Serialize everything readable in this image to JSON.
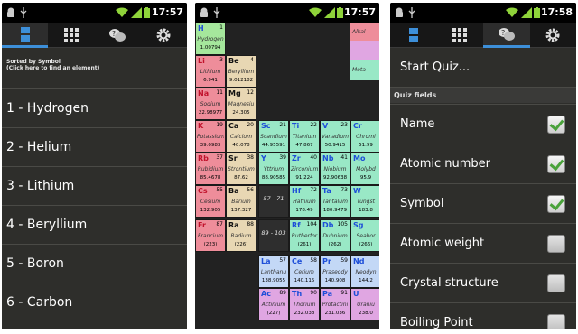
{
  "screens": [
    {
      "clock": "17:57",
      "tabs": [
        "elements-list",
        "periodic-table",
        "quiz",
        "settings"
      ],
      "sort_title": "Sorted by Symbol",
      "sort_hint": "(Click here to find an element)",
      "elements": [
        "1 - Hydrogen",
        "2 - Helium",
        "3 - Lithium",
        "4 - Beryllium",
        "5 - Boron",
        "6 - Carbon"
      ]
    },
    {
      "clock": "17:57",
      "legend": [
        "Alkal",
        "",
        "Meta"
      ],
      "cells": [
        {
          "sym": "H",
          "num": "1",
          "name": "Hydrogen",
          "weight": "1.00794"
        },
        {
          "sym": "Li",
          "num": "3",
          "name": "Lithium",
          "weight": "6.941"
        },
        {
          "sym": "Be",
          "num": "4",
          "name": "Beryllium",
          "weight": "9.012182"
        },
        {
          "sym": "Na",
          "num": "11",
          "name": "Sodium",
          "weight": "22.98977"
        },
        {
          "sym": "Mg",
          "num": "12",
          "name": "Magnesiu",
          "weight": "24.305"
        },
        {
          "sym": "K",
          "num": "19",
          "name": "Potassium",
          "weight": "39.0983"
        },
        {
          "sym": "Ca",
          "num": "20",
          "name": "Calcium",
          "weight": "40.078"
        },
        {
          "sym": "Sc",
          "num": "21",
          "name": "Scandium",
          "weight": "44.95591"
        },
        {
          "sym": "Ti",
          "num": "22",
          "name": "Titanium",
          "weight": "47.867"
        },
        {
          "sym": "V",
          "num": "23",
          "name": "Vanadium",
          "weight": "50.9415"
        },
        {
          "sym": "Cr",
          "num": "",
          "name": "Chromi",
          "weight": "51.99"
        },
        {
          "sym": "Rb",
          "num": "37",
          "name": "Rubidium",
          "weight": "85.4678"
        },
        {
          "sym": "Sr",
          "num": "38",
          "name": "Strontium",
          "weight": "87.62"
        },
        {
          "sym": "Y",
          "num": "39",
          "name": "Yttrium",
          "weight": "88.90585"
        },
        {
          "sym": "Zr",
          "num": "40",
          "name": "Zirconium",
          "weight": "91.224"
        },
        {
          "sym": "Nb",
          "num": "41",
          "name": "Niobium",
          "weight": "92.90638"
        },
        {
          "sym": "Mo",
          "num": "",
          "name": "Molybd",
          "weight": "95.9"
        },
        {
          "sym": "Cs",
          "num": "55",
          "name": "Cesium",
          "weight": "132.905"
        },
        {
          "sym": "Ba",
          "num": "56",
          "name": "Barium",
          "weight": "137.327"
        },
        {
          "sym": "Hf",
          "num": "72",
          "name": "Hafnium",
          "weight": "178.49"
        },
        {
          "sym": "Ta",
          "num": "73",
          "name": "Tantalum",
          "weight": "180.9479"
        },
        {
          "sym": "W",
          "num": "",
          "name": "Tungst",
          "weight": "183.8"
        },
        {
          "sym": "Fr",
          "num": "87",
          "name": "Francium",
          "weight": "(223)"
        },
        {
          "sym": "Ra",
          "num": "88",
          "name": "Radium",
          "weight": "(226)"
        },
        {
          "sym": "Rf",
          "num": "104",
          "name": "Rutherfor",
          "weight": "(261)"
        },
        {
          "sym": "Db",
          "num": "105",
          "name": "Dubnium",
          "weight": "(262)"
        },
        {
          "sym": "Sg",
          "num": "",
          "name": "Seabor",
          "weight": "(266)"
        },
        {
          "sym": "La",
          "num": "57",
          "name": "Lanthanu",
          "weight": "138.9055"
        },
        {
          "sym": "Ce",
          "num": "58",
          "name": "Cerium",
          "weight": "140.115"
        },
        {
          "sym": "Pr",
          "num": "59",
          "name": "Praseody",
          "weight": "140.908"
        },
        {
          "sym": "Nd",
          "num": "",
          "name": "Neodyn",
          "weight": "144.2"
        },
        {
          "sym": "Ac",
          "num": "89",
          "name": "Actinium",
          "weight": "(227)"
        },
        {
          "sym": "Th",
          "num": "90",
          "name": "Thorium",
          "weight": "232.038"
        },
        {
          "sym": "Pa",
          "num": "91",
          "name": "Protactini",
          "weight": "231.036"
        },
        {
          "sym": "U",
          "num": "",
          "name": "Uraniu",
          "weight": "238.0"
        }
      ],
      "ranges": [
        "57 - 71",
        "89 - 103"
      ]
    },
    {
      "clock": "17:58",
      "start_label": "Start Quiz...",
      "section_label": "Quiz fields",
      "fields": [
        {
          "label": "Name",
          "checked": true
        },
        {
          "label": "Atomic number",
          "checked": true
        },
        {
          "label": "Symbol",
          "checked": true
        },
        {
          "label": "Atomic weight",
          "checked": false
        },
        {
          "label": "Crystal structure",
          "checked": false
        },
        {
          "label": "Boiling Point",
          "checked": false
        }
      ]
    }
  ],
  "colors": {
    "alkali": "#ee8d9a",
    "alkaline": "#e8d7b3",
    "transition": "#99e8c6",
    "nonmetal": "#a5e79c",
    "lanthanide": "#c3d8f6",
    "actinide": "#e0a6e2",
    "tab_selected": "#3d8fd9"
  }
}
